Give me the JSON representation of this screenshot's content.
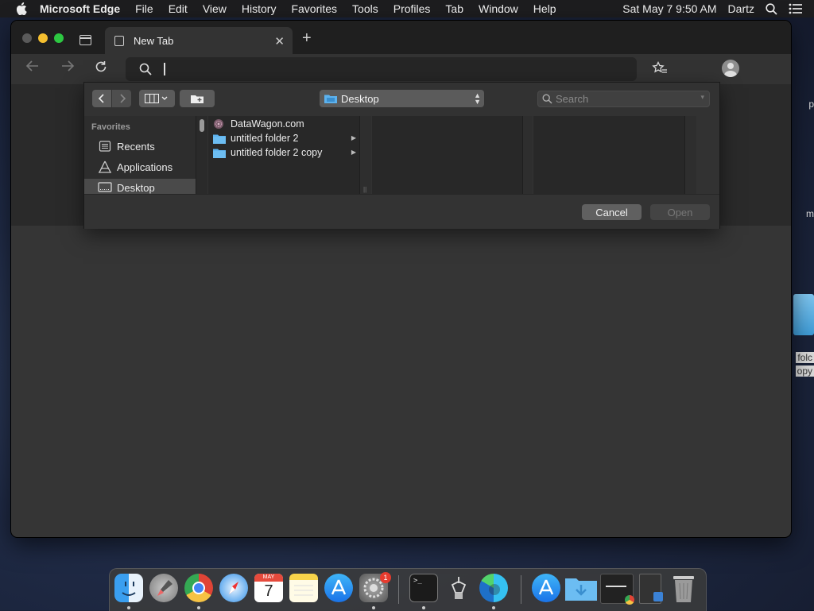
{
  "menubar": {
    "app_name": "Microsoft Edge",
    "items": [
      "File",
      "Edit",
      "View",
      "History",
      "Favorites",
      "Tools",
      "Profiles",
      "Tab",
      "Window",
      "Help"
    ],
    "datetime": "Sat May 7  9:50 AM",
    "user": "Dartz"
  },
  "desktop_peek": {
    "texts": [
      "p",
      "m",
      "folc",
      "opy"
    ]
  },
  "browser": {
    "tab_title": "New Tab",
    "new_tab_symbol": "+",
    "close_symbol": "✕",
    "address_value": ""
  },
  "dialog": {
    "location": "Desktop",
    "search_placeholder": "Search",
    "sidebar": {
      "header": "Favorites",
      "items": [
        "Recents",
        "Applications",
        "Desktop"
      ]
    },
    "files": [
      "DataWagon.com",
      "untitled folder 2",
      "untitled folder 2 copy"
    ],
    "cancel_label": "Cancel",
    "open_label": "Open"
  },
  "dock": {
    "apps": [
      "Finder",
      "Launchpad",
      "Google Chrome",
      "Safari",
      "Calendar",
      "Notes",
      "App Store",
      "System Preferences",
      "Terminal",
      "System Information",
      "Microsoft Edge",
      "App Store",
      "Folder",
      "Window",
      "Activity",
      "Trash"
    ],
    "calendar_month": "MAY",
    "calendar_day": "7",
    "terminal_prompt": ">_",
    "badge_count": "1"
  },
  "colors": {
    "accent_blue": "#4aa3e8",
    "folder_blue": "#5db2ee",
    "traffic_min": "#f5bf2f",
    "traffic_max": "#2dc842"
  }
}
